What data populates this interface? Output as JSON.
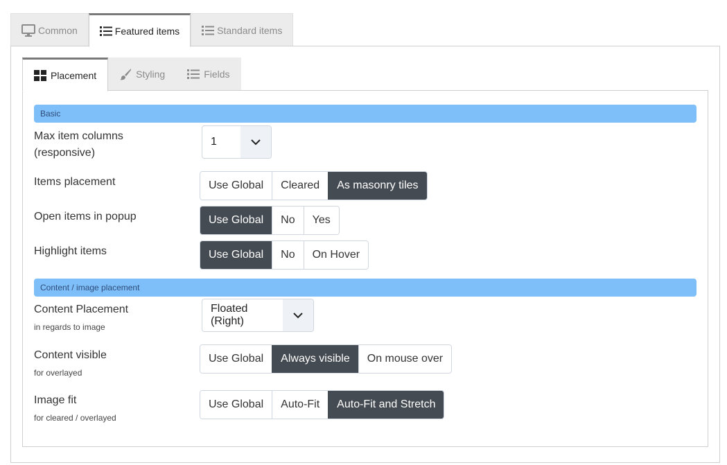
{
  "outer_tabs": [
    {
      "label": "Common",
      "icon": "monitor-icon",
      "active": false
    },
    {
      "label": "Featured items",
      "icon": "list-icon",
      "active": true
    },
    {
      "label": "Standard items",
      "icon": "list-icon",
      "active": false
    }
  ],
  "inner_tabs": [
    {
      "label": "Placement",
      "icon": "grid-icon",
      "active": true
    },
    {
      "label": "Styling",
      "icon": "brush-icon",
      "active": false
    },
    {
      "label": "Fields",
      "icon": "list-icon",
      "active": false
    }
  ],
  "sections": {
    "basic": "Basic",
    "content": "Content / image placement"
  },
  "fields": {
    "max_columns": {
      "label_line1": "Max item columns",
      "label_line2": "(responsive)",
      "value": "1"
    },
    "items_placement": {
      "label": "Items placement",
      "options": [
        "Use Global",
        "Cleared",
        "As masonry tiles"
      ],
      "selected": "As masonry tiles"
    },
    "open_popup": {
      "label": "Open items in popup",
      "options": [
        "Use Global",
        "No",
        "Yes"
      ],
      "selected": "Use Global"
    },
    "highlight": {
      "label": "Highlight items",
      "options": [
        "Use Global",
        "No",
        "On Hover"
      ],
      "selected": "Use Global"
    },
    "content_placement": {
      "label": "Content Placement",
      "sub": "in regards to image",
      "value": "Floated (Right)"
    },
    "content_visible": {
      "label": "Content visible",
      "sub": "for overlayed",
      "options": [
        "Use Global",
        "Always visible",
        "On mouse over"
      ],
      "selected": "Always visible"
    },
    "image_fit": {
      "label": "Image fit",
      "sub": "for cleared / overlayed",
      "options": [
        "Use Global",
        "Auto-Fit",
        "Auto-Fit and Stretch"
      ],
      "selected": "Auto-Fit and Stretch"
    }
  },
  "colors": {
    "section_bar": "#7fbff9",
    "active_button": "#454b52"
  }
}
